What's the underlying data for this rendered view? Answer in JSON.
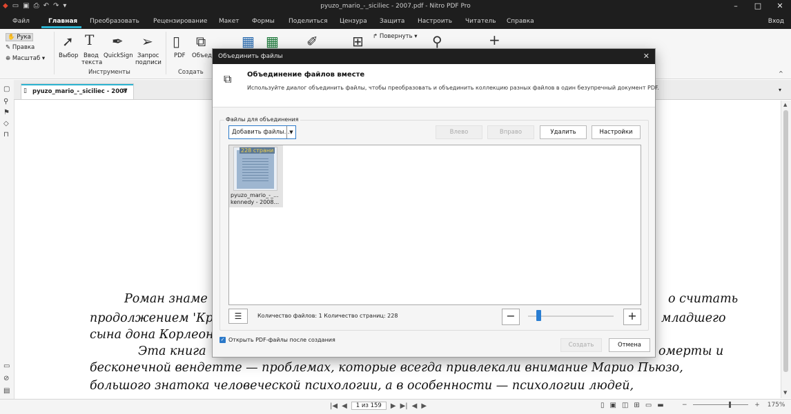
{
  "titlebar": {
    "title": "pyuzo_mario_-_siciliec - 2007.pdf - Nitro PDF Pro",
    "minimize": "–",
    "maximize": "□",
    "close": "✕"
  },
  "menu": {
    "items": [
      "Файл",
      "Главная",
      "Преобразовать",
      "Рецензирование",
      "Макет",
      "Формы",
      "Поделиться",
      "Цензура",
      "Защита",
      "Настроить",
      "Читатель",
      "Справка"
    ],
    "signin": "Вход"
  },
  "ribbon": {
    "side_tools": [
      "Рука",
      "Правка",
      "Масштаб"
    ],
    "tools": {
      "select": "Выбор",
      "type_text_1": "Ввод",
      "type_text_2": "текста",
      "quicksign": "QuickSign",
      "request_sign_1": "Запрос",
      "request_sign_2": "подписи",
      "group_tools": "Инструменты",
      "pdf": "PDF",
      "combine": "Объед",
      "group_create": "Создать",
      "rotate": "Повернуть"
    }
  },
  "doc_tab": {
    "label": "pyuzo_mario_-_siciliec - 2007"
  },
  "document": {
    "lines": [
      {
        "left": "Роман знаме",
        "right": "о считать"
      },
      {
        "left": "продолжением 'Кр",
        "right": "младшего"
      },
      {
        "left": "сына дона Корлеон",
        "right": ""
      },
      {
        "left": "Эта книга",
        "right": "омерты и"
      },
      {
        "full": "бесконечной вендетте — проблемах, которые всегда привлекали внимание Марио Пьюзо,"
      },
      {
        "full": "большого знатока человеческой психологии, а в особенности — психологии людей,"
      }
    ]
  },
  "status": {
    "page": "1 из 159",
    "zoom": "175%"
  },
  "dialog": {
    "title": "Объединить файлы",
    "heading": "Объединение файлов вместе",
    "description": "Используйте диалог объединить файлы, чтобы преобразовать и объединить коллекцию разных файлов в один безупречный документ PDF.",
    "files_legend": "Файлы для объединения",
    "add_files": "Добавить файлы...",
    "btn_left": "Влево",
    "btn_right": "Вправо",
    "btn_delete": "Удалить",
    "btn_settings": "Настройки",
    "file": {
      "badge": "228 страни",
      "name_line1": "pyuzo_mario_-_...",
      "name_line2": "kennedy - 2008..."
    },
    "counts": "Количество файлов: 1   Количество страниц: 228",
    "zoom_out": "−",
    "zoom_in": "+",
    "open_after": "Открыть PDF-файлы после создания",
    "create": "Создать",
    "cancel": "Отмена"
  }
}
